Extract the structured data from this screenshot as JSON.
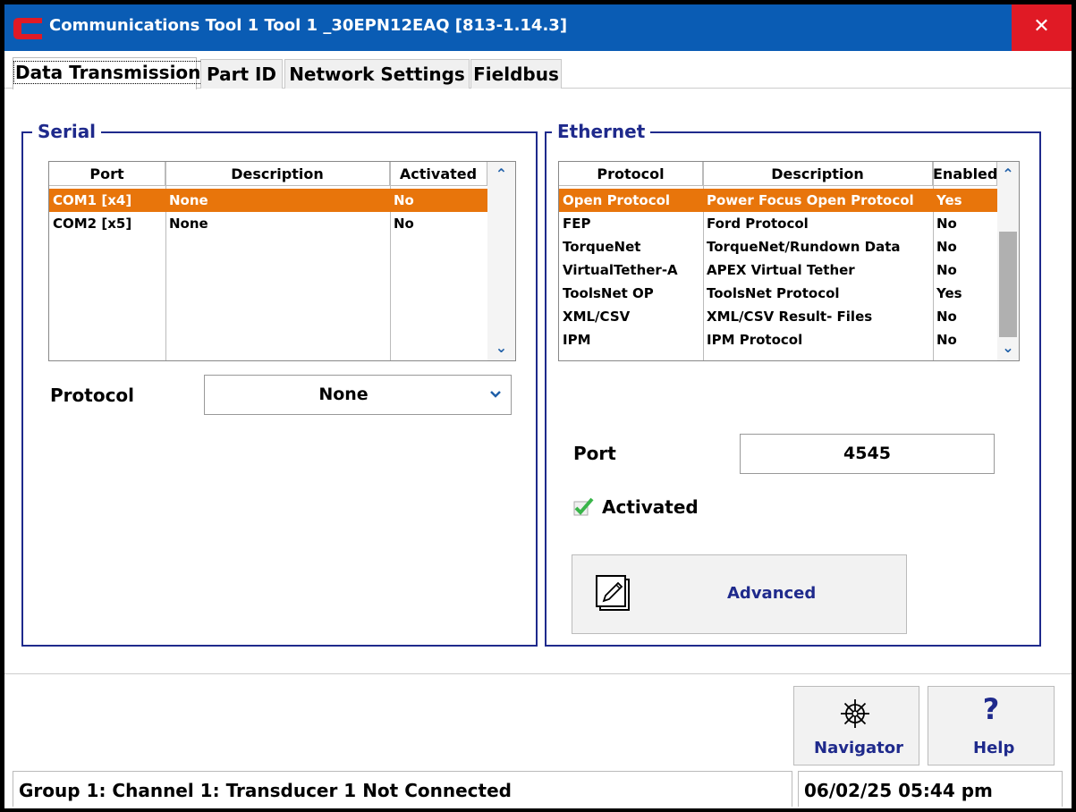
{
  "window": {
    "title": "Communications  Tool 1  Tool 1 _30EPN12EAQ [813-1.14.3]",
    "close_glyph": "✕"
  },
  "tabs": [
    {
      "label": "Data Transmission",
      "active": true
    },
    {
      "label": "Part ID",
      "active": false
    },
    {
      "label": "Network Settings",
      "active": false
    },
    {
      "label": "Fieldbus",
      "active": false
    }
  ],
  "serial": {
    "title": "Serial",
    "columns": [
      "Port",
      "Description",
      "Activated"
    ],
    "rows": [
      {
        "port": "COM1 [x4]",
        "description": "None",
        "activated": "No",
        "selected": true
      },
      {
        "port": "COM2 [x5]",
        "description": "None",
        "activated": "No",
        "selected": false
      }
    ],
    "protocol_label": "Protocol",
    "protocol_value": "None"
  },
  "ethernet": {
    "title": "Ethernet",
    "columns": [
      "Protocol",
      "Description",
      "Enabled"
    ],
    "rows": [
      {
        "protocol": "Open Protocol",
        "description": "Power Focus Open Protocol",
        "enabled": "Yes",
        "selected": true
      },
      {
        "protocol": "FEP",
        "description": "Ford Protocol",
        "enabled": "No",
        "selected": false
      },
      {
        "protocol": "TorqueNet",
        "description": "TorqueNet/Rundown Data",
        "enabled": "No",
        "selected": false
      },
      {
        "protocol": "VirtualTether-A",
        "description": "APEX Virtual Tether",
        "enabled": "No",
        "selected": false
      },
      {
        "protocol": "ToolsNet OP",
        "description": "ToolsNet Protocol",
        "enabled": "Yes",
        "selected": false
      },
      {
        "protocol": "XML/CSV",
        "description": "XML/CSV Result- Files",
        "enabled": "No",
        "selected": false
      },
      {
        "protocol": "IPM",
        "description": "IPM Protocol",
        "enabled": "No",
        "selected": false
      }
    ],
    "port_label": "Port",
    "port_value": "4545",
    "activated_label": "Activated",
    "activated_checked": true,
    "advanced_label": "Advanced"
  },
  "footer": {
    "navigator_label": "Navigator",
    "help_label": "Help",
    "help_glyph": "?",
    "status_text": "Group 1: Channel 1: Transducer 1 Not Connected",
    "datetime": "06/02/25 05:44 pm"
  },
  "colors": {
    "titlebar": "#0a5cb4",
    "close": "#e01a25",
    "selection": "#e8750b",
    "group_border": "#1f2a8c"
  },
  "icons": [
    "app-logo-icon",
    "close-icon",
    "scroll-up-icon",
    "scroll-down-icon",
    "dropdown-chevron-icon",
    "checkmark-icon",
    "edit-pen-icon",
    "navigator-wheel-icon",
    "help-question-icon"
  ]
}
